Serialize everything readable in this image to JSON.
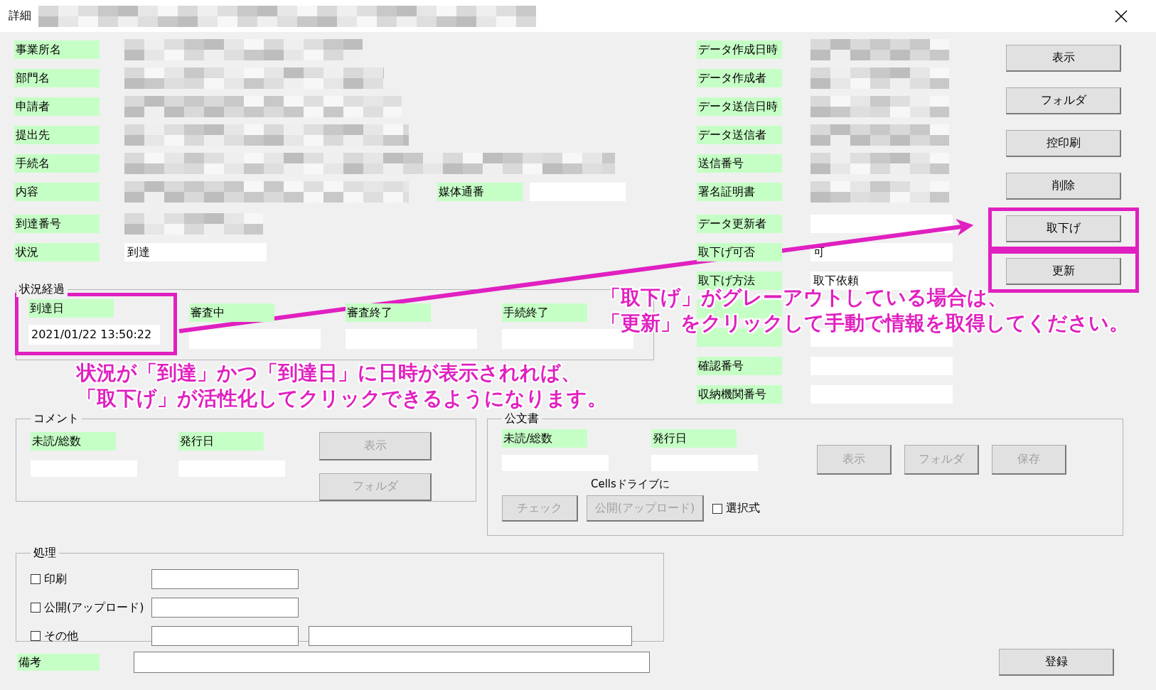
{
  "window": {
    "title": "詳細"
  },
  "left_fields": [
    {
      "label": "事業所名",
      "redacted": true
    },
    {
      "label": "部門名",
      "redacted": true
    },
    {
      "label": "申請者",
      "redacted": true
    },
    {
      "label": "提出先",
      "redacted": true
    },
    {
      "label": "手続名",
      "redacted": true
    },
    {
      "label": "内容",
      "redacted": true,
      "side": {
        "label": "媒体通番"
      }
    },
    {
      "label": "到達番号",
      "redacted": true
    },
    {
      "label": "状況",
      "redacted": false,
      "value": "到達"
    }
  ],
  "right_fields": [
    {
      "label": "データ作成日時",
      "redacted": true
    },
    {
      "label": "データ作成者",
      "redacted": true
    },
    {
      "label": "データ送信日時",
      "redacted": true
    },
    {
      "label": "データ送信者",
      "redacted": true
    },
    {
      "label": "送信番号",
      "redacted": true
    },
    {
      "label": "署名証明書",
      "redacted": true
    },
    {
      "label": "データ更新者",
      "redacted": false
    },
    {
      "label": "取下げ可否",
      "redacted": false,
      "value": "可"
    },
    {
      "label": "取下げ方法",
      "redacted": false,
      "value": "取下依頼"
    },
    {
      "redacted": false
    },
    {
      "redacted": false
    },
    {
      "label": "確認番号",
      "redacted": false
    },
    {
      "label": "収納機関番号",
      "redacted": false
    }
  ],
  "side_buttons": [
    {
      "label": "表示",
      "highlighted": false
    },
    {
      "label": "フォルダ",
      "highlighted": false
    },
    {
      "label": "控印刷",
      "highlighted": false
    },
    {
      "label": "削除",
      "highlighted": false
    },
    {
      "label": "取下げ",
      "highlighted": true
    },
    {
      "label": "更新",
      "highlighted": true
    }
  ],
  "progress": {
    "title": "状況経過",
    "stages": [
      {
        "label": "到達日",
        "value": "2021/01/22 13:50:22",
        "highlighted": true
      },
      {
        "label": "審査中",
        "highlighted": false
      },
      {
        "label": "審査終了",
        "highlighted": false
      },
      {
        "label": "手続終了",
        "highlighted": false
      }
    ]
  },
  "comment": {
    "title": "コメント",
    "fields": [
      {
        "label": "未読/総数"
      },
      {
        "label": "発行日"
      }
    ],
    "buttons": [
      {
        "label": "表示",
        "disabled": true
      },
      {
        "label": "フォルダ",
        "disabled": true
      }
    ]
  },
  "official": {
    "title": "公文書",
    "fields": [
      {
        "label": "未読/総数"
      },
      {
        "label": "発行日"
      }
    ],
    "buttons": [
      {
        "label": "表示",
        "disabled": true
      },
      {
        "label": "フォルダ",
        "disabled": true
      },
      {
        "label": "保存",
        "disabled": true
      }
    ],
    "cells_label": "Cellsドライブに",
    "cells_buttons": [
      {
        "label": "チェック",
        "disabled": true
      },
      {
        "label": "公開(アップロード)",
        "disabled": true
      }
    ],
    "checkbox": {
      "label": "選択式",
      "checked": false
    }
  },
  "processing": {
    "title": "処理",
    "items": [
      {
        "label": "印刷",
        "checked": false,
        "kind": "plain"
      },
      {
        "label": "公開(アップロード)",
        "checked": false,
        "kind": "plain"
      },
      {
        "label": "その他",
        "checked": false,
        "kind": "with-note"
      }
    ]
  },
  "remarks": {
    "label": "備考"
  },
  "register_button": "登録",
  "annotations": [
    {
      "lines": [
        "「取下げ」がグレーアウトしている場合は、",
        "「更新」をクリックして手動で情報を取得してください。"
      ]
    },
    {
      "lines": [
        "状況が「到達」かつ「到達日」に日時が表示されれば、",
        "「取下げ」が活性化してクリックできるようになります。"
      ]
    }
  ]
}
